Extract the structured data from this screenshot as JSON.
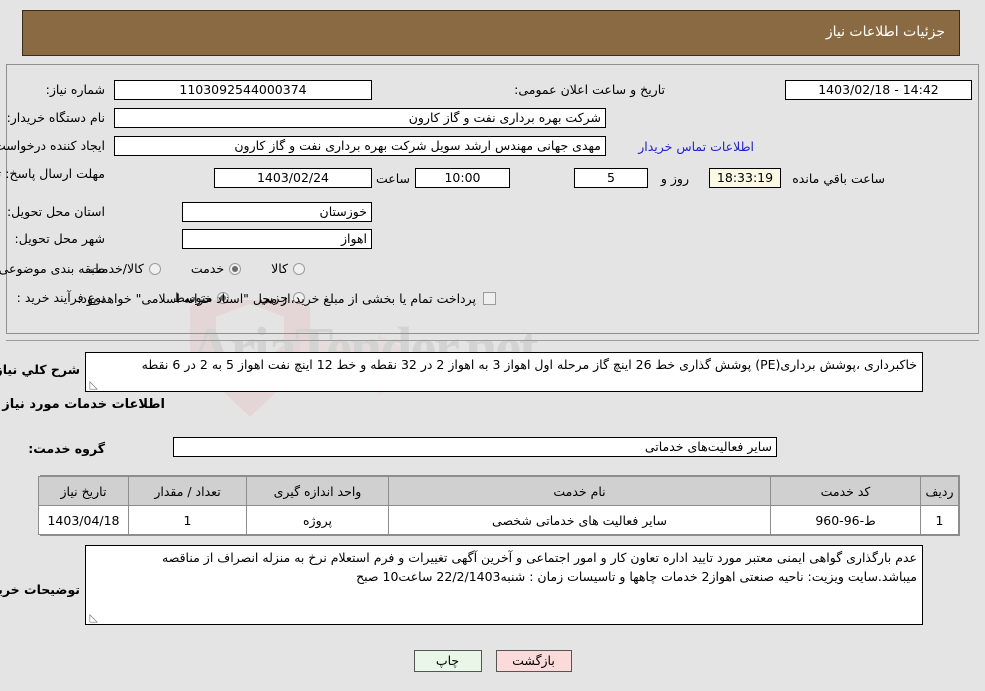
{
  "header": {
    "title": "جزئیات اطلاعات نیاز"
  },
  "form": {
    "need_number_label": "شماره نیاز:",
    "need_number_value": "1103092544000374",
    "announce_label": "تاریخ و ساعت اعلان عمومی:",
    "announce_value": "14:42 - 1403/02/18",
    "buyer_org_label": "نام دستگاه خریدار:",
    "buyer_org_value": "شرکت بهره برداری نفت و گاز کارون",
    "creator_label": "ایجاد کننده درخواست:",
    "creator_value": "مهدی جهانی مهندس ارشد سویل شرکت بهره برداری نفت و گاز کارون",
    "contact_link": "اطلاعات تماس خریدار",
    "deadline_label": "مهلت ارسال پاسخ: تا تاریخ:",
    "deadline_date": "1403/02/24",
    "hour_label": "ساعت",
    "deadline_time": "10:00",
    "days_value": "5",
    "days_label": "روز و",
    "remaining_time": "18:33:19",
    "remaining_label": "ساعت باقي مانده",
    "province_label": "استان محل تحویل:",
    "province_value": "خوزستان",
    "city_label": "شهر محل تحویل:",
    "city_value": "اهواز",
    "category_label": "طبقه بندی موضوعی:",
    "category_options": [
      {
        "label": "کالا",
        "selected": false
      },
      {
        "label": "خدمت",
        "selected": true
      },
      {
        "label": "کالا/خدمت",
        "selected": false
      }
    ],
    "process_label": "نوع فرآیند خرید :",
    "process_options": [
      {
        "label": "جزیي",
        "selected": false
      },
      {
        "label": "متوسط",
        "selected": true
      }
    ],
    "treasury_checkbox_label": "پرداخت تمام یا بخشی از مبلغ خرید،از محل \"اسناد خزانه اسلامی\" خواهد بود.",
    "treasury_checked": false
  },
  "description": {
    "label": "شرح کلي نیاز:",
    "text": "خاکبرداری ،پوشش برداری(PE) پوشش گذاری خط 26 اینچ گاز مرحله اول اهواز 3 به اهواز 2  در 32  نقطه و خط 12 اینچ نفت اهواز 5 به 2 در 6 نقطه"
  },
  "services_section": {
    "heading": "اطلاعات خدمات مورد نیاز",
    "group_label": "گروه خدمت:",
    "group_value": "سایر فعالیت‌های خدماتی"
  },
  "table": {
    "columns": [
      "ردیف",
      "کد خدمت",
      "نام خدمت",
      "واحد اندازه گیری",
      "تعداد / مقدار",
      "تاریخ نیاز"
    ],
    "rows": [
      {
        "index": "1",
        "code": "ط-96-960",
        "name": "سایر فعالیت های خدماتی شخصی",
        "unit": "پروژه",
        "qty": "1",
        "date": "1403/04/18"
      }
    ]
  },
  "notes": {
    "label": "توضیحات خریدار:",
    "text": "عدم بارگذاری گواهی ایمنی معتبر مورد تایید اداره تعاون کار و امور اجتماعی و آخرین آگهی تغییرات و فرم استعلام نرخ به منزله انصراف از مناقصه میباشد.سایت ویزیت: ناحیه صنعتی اهواز2 خدمات چاهها و تاسیسات زمان : شنبه22/2/1403 ساعت10 صبح"
  },
  "footer": {
    "print_label": "چاپ",
    "back_label": "بازگشت"
  },
  "watermark": {
    "text": "AriaTender.net"
  },
  "colors": {
    "header_bg": "#8a6a42",
    "link": "#2222cc",
    "print_btn": "#e9f7e9",
    "back_btn": "#fbdada"
  }
}
